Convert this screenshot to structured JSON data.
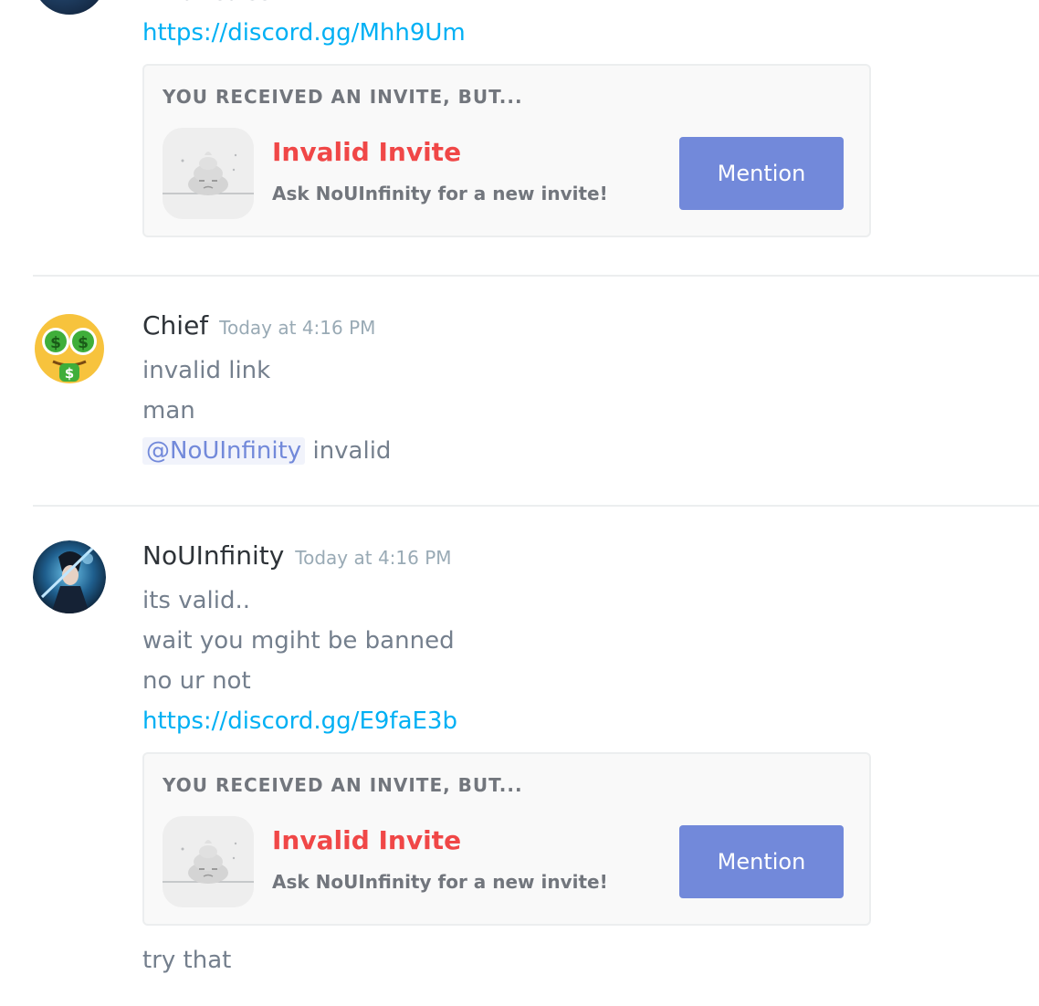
{
  "top": {
    "cut_text": "What calss",
    "link": "https://discord.gg/Mhh9Um",
    "invite": {
      "header": "YOU RECEIVED AN INVITE, BUT...",
      "title": "Invalid Invite",
      "subtitle": "Ask NoUInfinity for a new invite!",
      "button": "Mention"
    }
  },
  "msg_chief": {
    "username": "Chief",
    "timestamp": "Today at 4:16 PM",
    "lines": [
      "invalid link",
      "man"
    ],
    "mention": "@NoUInfinity",
    "after_mention": " invalid"
  },
  "msg_nou": {
    "username": "NoUInfinity",
    "timestamp": "Today at 4:16 PM",
    "lines": [
      "its valid..",
      "wait you mgiht be banned",
      "no ur not"
    ],
    "link": "https://discord.gg/E9faE3b",
    "invite": {
      "header": "YOU RECEIVED AN INVITE, BUT...",
      "title": "Invalid Invite",
      "subtitle": "Ask NoUInfinity for a new invite!",
      "button": "Mention"
    },
    "after_invite": "try that"
  },
  "colors": {
    "link": "#00b0f4",
    "invalid": "#f04747",
    "button": "#7289da",
    "mention": "#7289da"
  }
}
